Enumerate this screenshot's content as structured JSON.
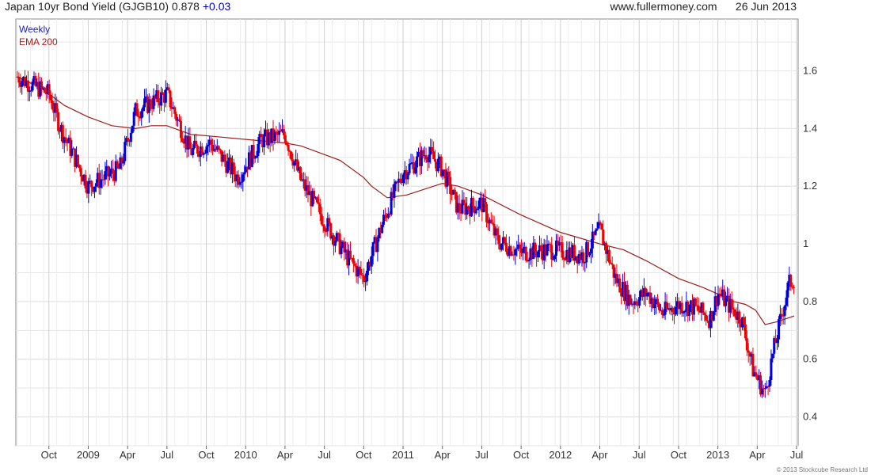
{
  "header": {
    "title": "Japan 10yr Bond Yield (GJGB10)",
    "last_value": "0.878",
    "change": "+0.03",
    "site": "www.fullermoney.com",
    "date": "26 Jun 2013"
  },
  "footer": {
    "copyright": "© 2013 Stockcube Research Ltd"
  },
  "colors": {
    "up": "#0000dd",
    "down": "#ee0000",
    "ema": "#9b1c1c",
    "grid": "#cfcfcf"
  },
  "chart_data": {
    "type": "line",
    "title": "Japan 10yr Bond Yield (GJGB10)",
    "legend": [
      "Weekly",
      "EMA 200"
    ],
    "legend_position": "top-left",
    "grid": true,
    "x_ticks": [
      "Oct",
      "2009",
      "Apr",
      "Jul",
      "Oct",
      "2010",
      "Apr",
      "Jul",
      "Oct",
      "2011",
      "Apr",
      "Jul",
      "Oct",
      "2012",
      "Apr",
      "Jul",
      "Oct",
      "2013",
      "Apr",
      "Jul"
    ],
    "x_tick_positions": [
      1.0,
      1.5,
      2.0,
      2.5,
      3.0,
      3.5,
      4.0,
      4.5,
      5.0,
      5.5,
      6.0,
      6.5,
      7.0,
      7.5,
      8.0,
      8.5,
      9.0,
      9.5,
      10.0,
      10.5
    ],
    "x_range": [
      0.58,
      10.52
    ],
    "y_ticks": [
      0.4,
      0.6,
      0.8,
      1.0,
      1.2,
      1.4,
      1.6
    ],
    "y_tick_labels": [
      "0.4",
      "0.6",
      "0.8",
      "1",
      "1.2",
      "1.4",
      "1.6"
    ],
    "ylim": [
      0.3,
      1.78
    ],
    "series": [
      {
        "name": "Weekly",
        "style": "candlestick",
        "x": [
          0.6,
          1.0,
          1.15,
          1.5,
          1.9,
          2.1,
          2.5,
          2.8,
          3.05,
          3.4,
          3.7,
          4.0,
          4.2,
          4.5,
          4.8,
          5.0,
          5.25,
          5.5,
          5.65,
          5.8,
          6.0,
          6.2,
          6.5,
          6.7,
          7.0,
          7.4,
          7.8,
          8.0,
          8.2,
          8.4,
          8.6,
          8.8,
          9.0,
          9.2,
          9.4,
          9.5,
          9.6,
          9.8,
          9.95,
          10.1,
          10.2,
          10.3,
          10.4,
          10.47
        ],
        "close": [
          1.58,
          1.52,
          1.4,
          1.2,
          1.26,
          1.46,
          1.52,
          1.32,
          1.35,
          1.23,
          1.36,
          1.38,
          1.22,
          1.08,
          0.95,
          0.88,
          1.08,
          1.25,
          1.28,
          1.32,
          1.26,
          1.12,
          1.14,
          1.01,
          0.97,
          0.98,
          0.96,
          1.05,
          0.88,
          0.8,
          0.83,
          0.76,
          0.79,
          0.78,
          0.74,
          0.83,
          0.8,
          0.74,
          0.56,
          0.48,
          0.62,
          0.74,
          0.86,
          0.88
        ]
      },
      {
        "name": "EMA 200",
        "style": "line",
        "x": [
          0.6,
          0.9,
          1.2,
          1.5,
          1.8,
          2.1,
          2.3,
          2.5,
          2.8,
          3.2,
          3.6,
          4.0,
          4.2,
          4.5,
          4.7,
          5.0,
          5.1,
          5.3,
          5.55,
          6.0,
          6.2,
          6.5,
          7.0,
          7.5,
          8.0,
          8.3,
          8.6,
          9.0,
          9.3,
          9.55,
          9.7,
          9.85,
          9.98,
          10.1,
          10.25,
          10.47
        ],
        "values": [
          1.58,
          1.54,
          1.48,
          1.44,
          1.41,
          1.4,
          1.41,
          1.41,
          1.38,
          1.37,
          1.36,
          1.35,
          1.34,
          1.31,
          1.29,
          1.23,
          1.2,
          1.16,
          1.17,
          1.21,
          1.2,
          1.17,
          1.1,
          1.04,
          1.0,
          0.98,
          0.94,
          0.88,
          0.85,
          0.82,
          0.8,
          0.79,
          0.77,
          0.72,
          0.73,
          0.75
        ]
      }
    ]
  }
}
